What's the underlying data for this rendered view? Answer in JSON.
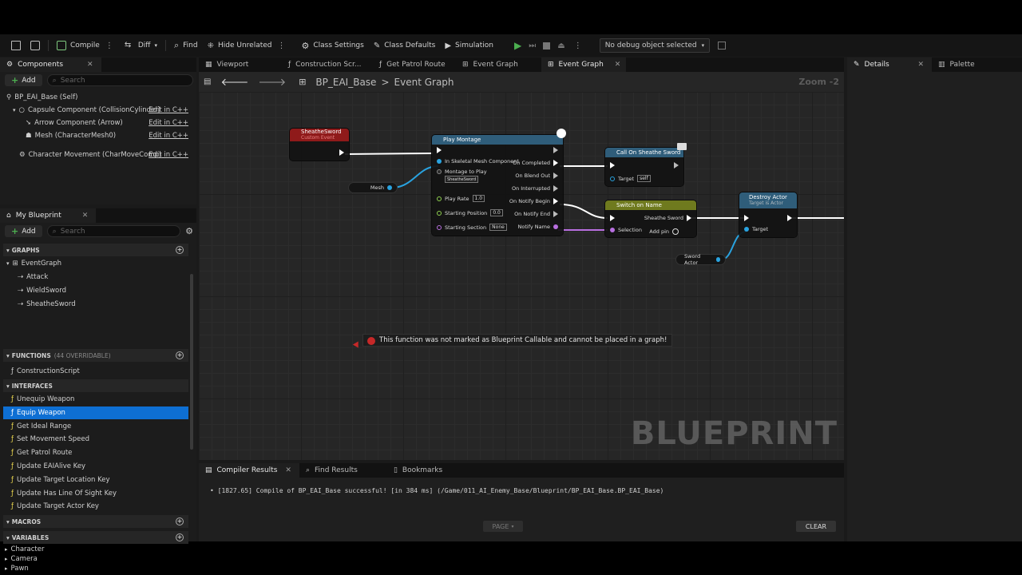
{
  "toolbar": {
    "compile": "Compile",
    "diff": "Diff",
    "find": "Find",
    "hide_unrelated": "Hide Unrelated",
    "class_settings": "Class Settings",
    "class_defaults": "Class Defaults",
    "simulation": "Simulation",
    "debug_object": "No debug object selected"
  },
  "components_panel": {
    "tab": "Components",
    "add": "Add",
    "search_placeholder": "Search",
    "items": [
      {
        "label": "BP_EAI_Base (Self)",
        "action": ""
      },
      {
        "label": "Capsule Component (CollisionCylinder)",
        "action": "Edit in C++"
      },
      {
        "label": "Arrow Component (Arrow)",
        "action": "Edit in C++"
      },
      {
        "label": "Mesh (CharacterMesh0)",
        "action": "Edit in C++"
      },
      {
        "label": "Character Movement (CharMoveComp)",
        "action": "Edit in C++"
      }
    ]
  },
  "my_blueprint": {
    "tab": "My Blueprint",
    "add": "Add",
    "search_placeholder": "Search",
    "graphs_header": "GRAPHS",
    "graphs": [
      "EventGraph",
      "Attack",
      "WieldSword",
      "SheatheSword"
    ],
    "functions_header": "FUNCTIONS",
    "functions_count": "(44 OVERRIDABLE)",
    "functions": [
      "ConstructionScript"
    ],
    "interfaces_header": "INTERFACES",
    "interfaces": [
      "Unequip Weapon",
      "Equip Weapon",
      "Get Ideal Range",
      "Set Movement Speed",
      "Get Patrol Route",
      "Update EAIAlive Key",
      "Update Target Location Key",
      "Update Has Line Of Sight Key",
      "Update Target Actor Key"
    ],
    "macros_header": "MACROS",
    "variables_header": "VARIABLES",
    "variables": [
      "Character",
      "Camera",
      "Pawn"
    ]
  },
  "editor_tabs": [
    "Viewport",
    "Construction Scr...",
    "Get Patrol Route",
    "Event Graph",
    "Event Graph"
  ],
  "breadcrumb": {
    "root": "BP_EAI_Base",
    "sep": ">",
    "current": "Event Graph"
  },
  "zoom": "Zoom -2",
  "nodes": {
    "sheathe_event": {
      "title": "SheatheSword",
      "subtitle": "Custom Event"
    },
    "mesh_getter": "Mesh",
    "play_montage": {
      "title": "Play Montage",
      "inputs": [
        "In Skeletal Mesh Component",
        "Montage to Play",
        "Play Rate",
        "Starting Position",
        "Starting Section"
      ],
      "montage_value": "SheatheSword",
      "play_rate": "1.0",
      "starting_position": "0.0",
      "starting_section": "None",
      "outputs": [
        "On Completed",
        "On Blend Out",
        "On Interrupted",
        "On Notify Begin",
        "On Notify End",
        "Notify Name"
      ]
    },
    "call_sheathe": {
      "title": "Call On Sheathe Sword",
      "target_label": "Target",
      "target_value": "self"
    },
    "switch_name": {
      "title": "Switch on Name",
      "selection": "Selection",
      "output": "Sheathe Sword",
      "add_pin": "Add pin"
    },
    "destroy_actor": {
      "title": "Destroy Actor",
      "subtitle": "Target is Actor",
      "target": "Target"
    },
    "sword_actor": "Sword Actor"
  },
  "error_message": "This function was not marked as Blueprint Callable and cannot be placed in a graph!",
  "watermark": "BLUEPRINT",
  "bottom_panel": {
    "tabs": [
      "Compiler Results",
      "Find Results",
      "Bookmarks"
    ],
    "log": "[1827.65] Compile of BP_EAI_Base successful! [in 384 ms] (/Game/011_AI_Enemy_Base/Blueprint/BP_EAI_Base.BP_EAI_Base)",
    "page": "PAGE",
    "clear": "CLEAR"
  },
  "right_panel": {
    "details": "Details",
    "palette": "Palette"
  },
  "colors": {
    "selection": "#0e6fd3",
    "event_red": "#9b1c1c",
    "function_blue": "#2f5d7a",
    "switch_olive": "#6f7a1e",
    "error": "#c62828",
    "pin_blue": "#29a3e0",
    "pin_green": "#8fd14f",
    "pin_purple": "#b86fe0"
  }
}
